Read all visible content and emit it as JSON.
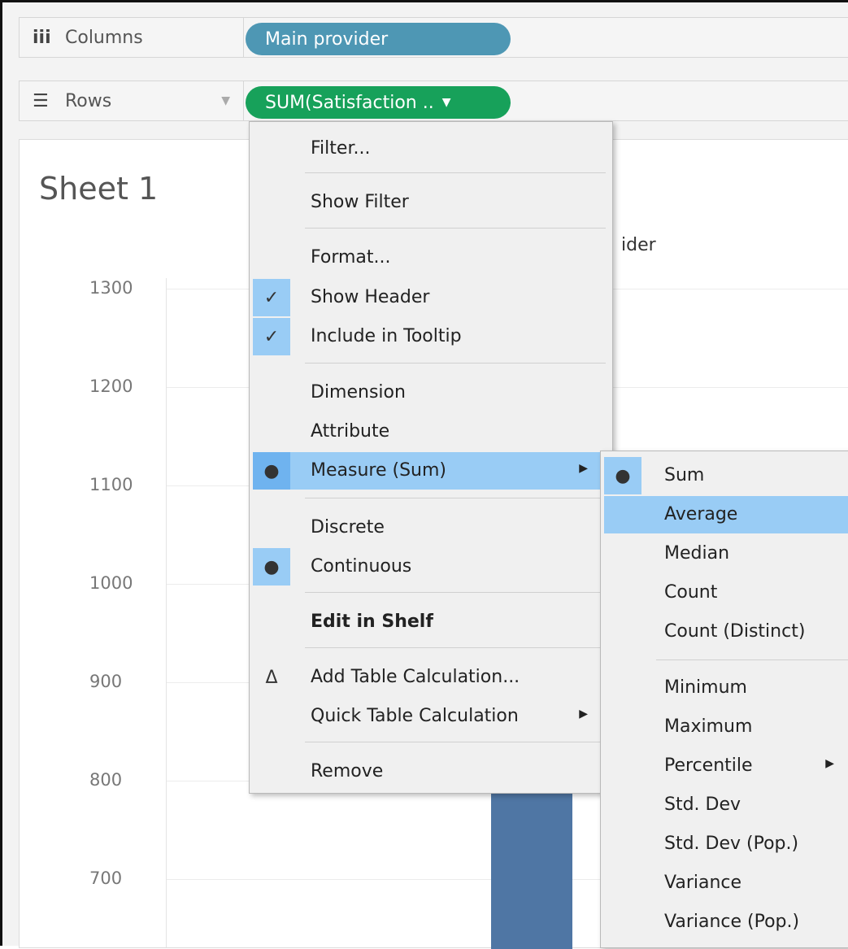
{
  "columns_shelf": {
    "label": "Columns",
    "icon": "columns-icon",
    "pill": "Main provider"
  },
  "rows_shelf": {
    "label": "Rows",
    "icon": "rows-icon",
    "pill": "SUM(Satisfaction .."
  },
  "sheet": {
    "title": "Sheet 1",
    "column_header_fragment": "ider",
    "y_ticks": [
      "1300",
      "1200",
      "1100",
      "1000",
      "900",
      "800",
      "700"
    ]
  },
  "context_menu": {
    "filter": "Filter...",
    "show_filter": "Show Filter",
    "format": "Format...",
    "show_header": "Show Header",
    "include_tooltip": "Include in Tooltip",
    "dimension": "Dimension",
    "attribute": "Attribute",
    "measure": "Measure (Sum)",
    "discrete": "Discrete",
    "continuous": "Continuous",
    "edit_in_shelf": "Edit in Shelf",
    "add_table_calc": "Add Table Calculation...",
    "quick_table_calc": "Quick Table Calculation",
    "remove": "Remove"
  },
  "measure_submenu": {
    "sum": "Sum",
    "average": "Average",
    "median": "Median",
    "count": "Count",
    "count_distinct": "Count (Distinct)",
    "minimum": "Minimum",
    "maximum": "Maximum",
    "percentile": "Percentile",
    "std_dev": "Std. Dev",
    "std_dev_pop": "Std. Dev (Pop.)",
    "variance": "Variance",
    "variance_pop": "Variance (Pop.)"
  },
  "colors": {
    "columns_pill": "#4e97b4",
    "rows_pill": "#17a15a",
    "bar": "#4f76a4",
    "highlight": "#99ccf5"
  }
}
